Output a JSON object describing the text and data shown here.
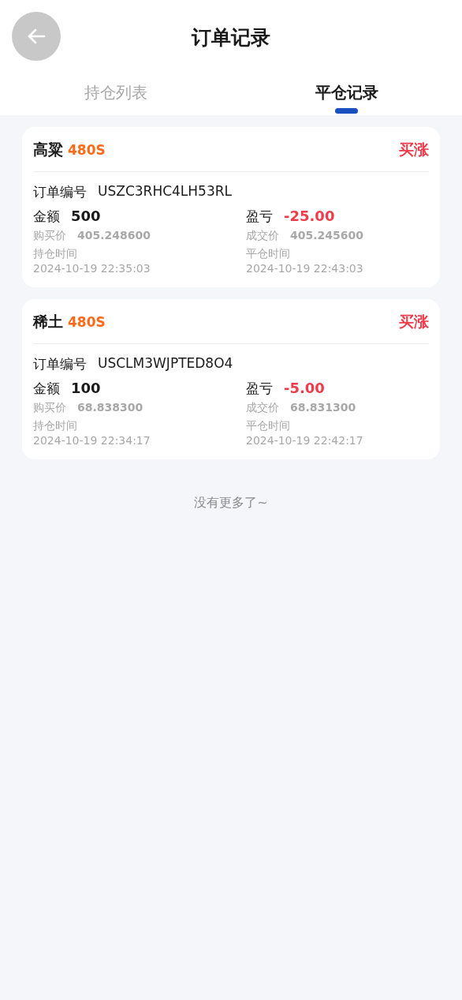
{
  "header": {
    "title": "订单记录"
  },
  "tabs": [
    {
      "label": "持仓列表",
      "selected": false
    },
    {
      "label": "平仓记录",
      "selected": true
    }
  ],
  "orders": [
    {
      "name": "高粱",
      "period": "480S",
      "direction": "买涨",
      "order_no_label": "订单编号",
      "order_no": "USZC3RHC4LH53RL",
      "amount_label": "金额",
      "amount": "500",
      "pnl_label": "盈亏",
      "pnl": "-25.00",
      "buy_price_label": "购买价",
      "buy_price": "405.248600",
      "deal_price_label": "成交价",
      "deal_price": "405.245600",
      "hold_time_label": "持仓时间",
      "hold_time": "2024-10-19 22:35:03",
      "close_time_label": "平仓时间",
      "close_time": "2024-10-19 22:43:03"
    },
    {
      "name": "稀土",
      "period": "480S",
      "direction": "买涨",
      "order_no_label": "订单编号",
      "order_no": "USCLM3WJPTED8O4",
      "amount_label": "金额",
      "amount": "100",
      "pnl_label": "盈亏",
      "pnl": "-5.00",
      "buy_price_label": "购买价",
      "buy_price": "68.838300",
      "deal_price_label": "成交价",
      "deal_price": "68.831300",
      "hold_time_label": "持仓时间",
      "hold_time": "2024-10-19 22:34:17",
      "close_time_label": "平仓时间",
      "close_time": "2024-10-19 22:42:17"
    }
  ],
  "footer_note": "没有更多了~"
}
